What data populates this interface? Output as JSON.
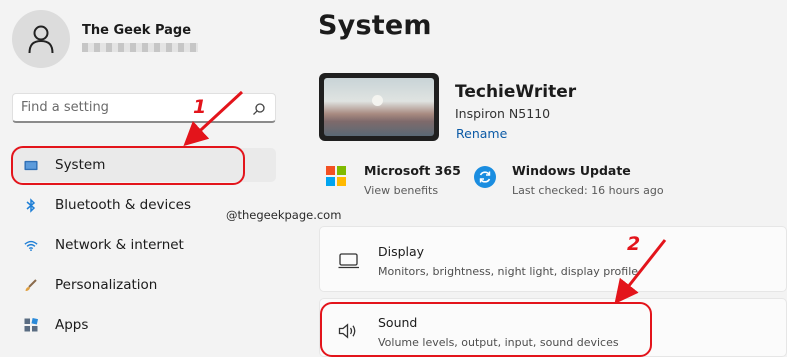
{
  "user": {
    "name": "The Geek Page"
  },
  "search": {
    "placeholder": "Find a setting"
  },
  "nav": [
    {
      "label": "System",
      "icon": "monitor-icon",
      "active": true
    },
    {
      "label": "Bluetooth & devices",
      "icon": "bluetooth-icon"
    },
    {
      "label": "Network & internet",
      "icon": "wifi-icon"
    },
    {
      "label": "Personalization",
      "icon": "brush-icon"
    },
    {
      "label": "Apps",
      "icon": "apps-icon"
    }
  ],
  "main": {
    "title": "System",
    "device": {
      "name": "TechieWriter",
      "model": "Inspiron N5110",
      "rename": "Rename"
    },
    "ms365": {
      "title": "Microsoft 365",
      "sub": "View benefits"
    },
    "windows_update": {
      "title": "Windows Update",
      "sub": "Last checked: 16 hours ago"
    },
    "cards": [
      {
        "title": "Display",
        "sub": "Monitors, brightness, night light, display profile",
        "icon": "display-icon"
      },
      {
        "title": "Sound",
        "sub": "Volume levels, output, input, sound devices",
        "icon": "speaker-icon"
      }
    ]
  },
  "watermark": "@thegeekpage.com",
  "annotations": {
    "step1": "1",
    "step2": "2",
    "color": "#e3141b"
  },
  "colors": {
    "accent": "#0b5aa6",
    "windows_update": "#1a8de0"
  }
}
